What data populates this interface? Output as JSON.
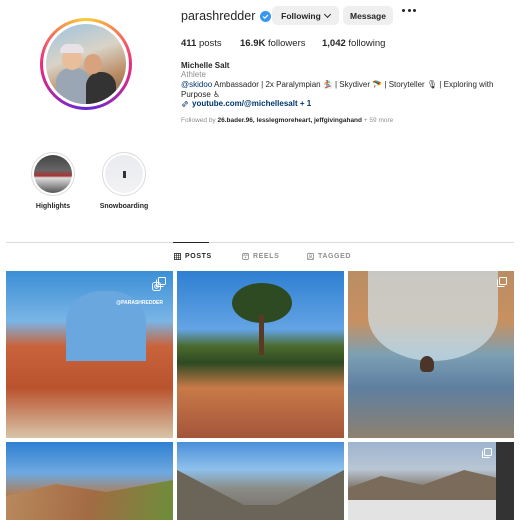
{
  "profile": {
    "username": "parashredder",
    "following_label": "Following",
    "message_label": "Message",
    "posts_count": "411",
    "posts_label": "posts",
    "followers_count": "16.9K",
    "followers_label": "followers",
    "following_count": "1,042",
    "following_text": "following",
    "full_name": "Michelle Salt",
    "category": "Athlete",
    "bio_mention": "@skidoo",
    "bio_text": " Ambassador | 2x Paralympian 🏂 | Skydiver 🪂 | Storyteller 🎙 | Exploring with Purpose ♿",
    "link_text": "youtube.com/@michellesalt + 1",
    "followed_by_prefix": "Followed by ",
    "followed_by_names": "26.bader.96, lesslegmoreheart, jeffgivingahand",
    "followed_by_suffix": " + 59 more"
  },
  "highlights": [
    {
      "label": "Highlights"
    },
    {
      "label": "Snowboarding"
    }
  ],
  "tabs": {
    "posts": "POSTS",
    "reels": "REELS",
    "tagged": "TAGGED"
  },
  "grid": {
    "tile1_caption": "@PARASHREDDER"
  },
  "colors": {
    "link": "#00376b",
    "verified": "#3897f0",
    "secondary_text": "#8e8e8e"
  }
}
